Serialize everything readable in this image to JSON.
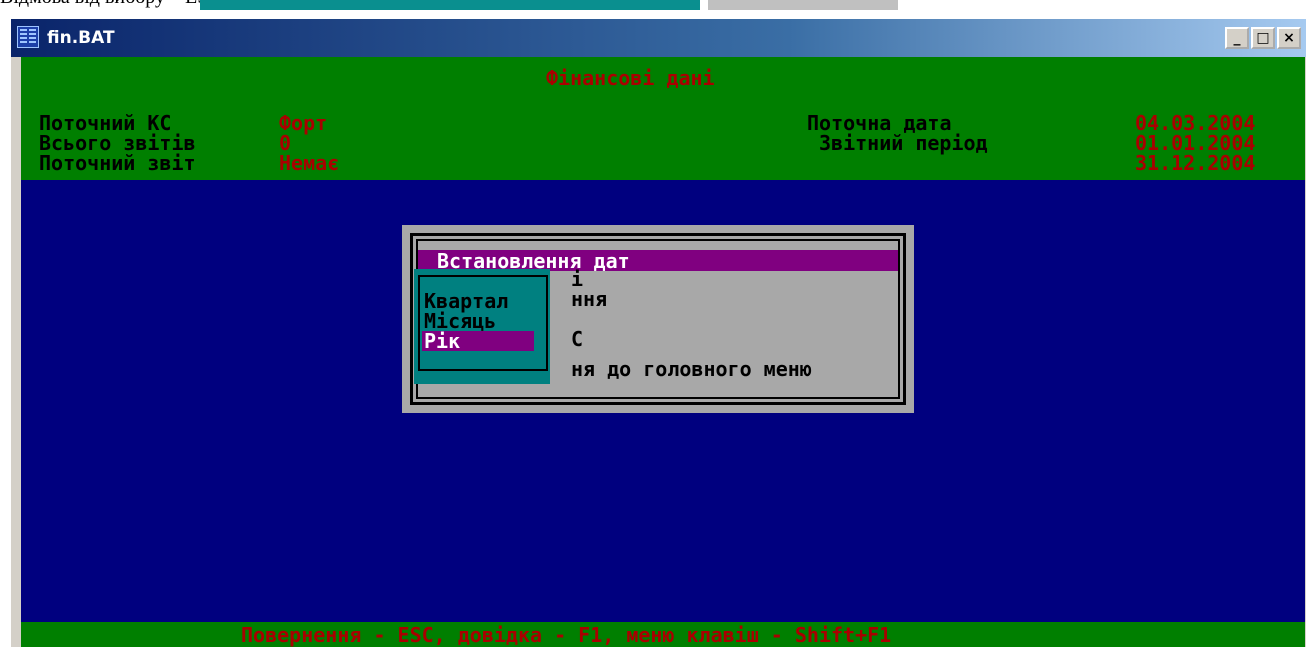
{
  "document": {
    "partial_text": "Відмова від вибору – ESC."
  },
  "window": {
    "title": "fin.BAT",
    "buttons": {
      "minimize": "_",
      "maximize": "□",
      "close": "×"
    }
  },
  "header": {
    "title": "Фінансові дані",
    "left": [
      {
        "label": "Поточний КС",
        "value": "Форт"
      },
      {
        "label": "Всього звітів",
        "value": "0"
      },
      {
        "label": "Поточний звіт",
        "value": "Немає"
      }
    ],
    "right": {
      "current_date_label": "Поточна дата",
      "current_date": "04.03.2004",
      "period_label": "Звітний період",
      "period_start": "01.01.2004",
      "period_end": "31.12.2004"
    }
  },
  "dialog": {
    "title": "Встановлення дат",
    "items_partial": [
      "і",
      "ння",
      "С",
      "ня до головного меню"
    ]
  },
  "submenu": {
    "items": [
      "Квартал",
      "Місяць",
      "Рік"
    ],
    "selected": "Рік"
  },
  "footer": {
    "hint": "Повернення - ESC, довідка - F1, меню клавіш - Shift+F1"
  },
  "colors": {
    "console_bg": "#00007f",
    "header_bg": "#007f00",
    "value_red": "#aa0000",
    "dialog_bg": "#a8a8a8",
    "highlight": "#800080",
    "submenu_bg": "#008080"
  }
}
